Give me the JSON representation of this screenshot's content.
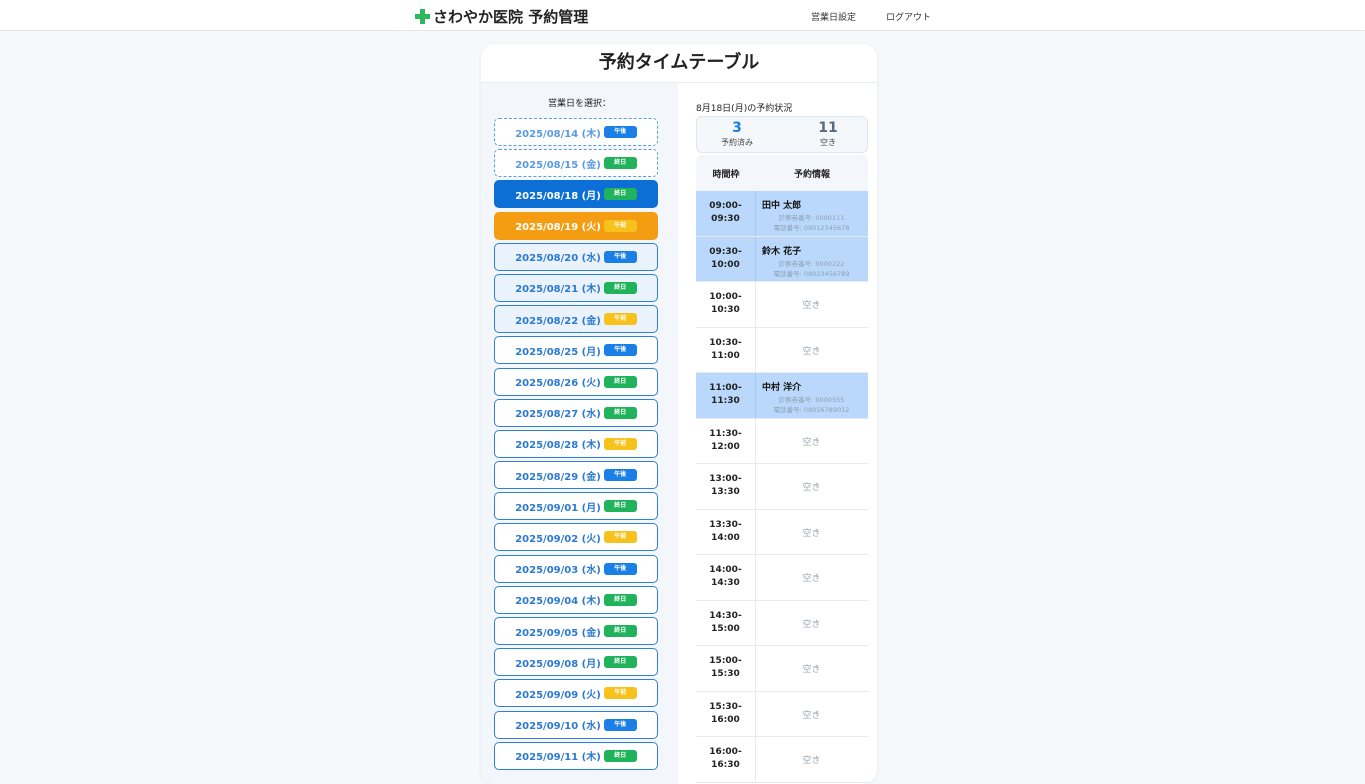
{
  "header": {
    "logo_text": "さわやか医院 予約管理",
    "nav_business_days": "営業日設定",
    "nav_logout": "ログアウト"
  },
  "page": {
    "title": "予約タイムテーブル"
  },
  "left": {
    "label": "営業日を選択：",
    "dates": [
      {
        "label": "2025/08/14 (木)",
        "badge": "午後",
        "badge_type": "afternoon",
        "state": "past"
      },
      {
        "label": "2025/08/15 (金)",
        "badge": "終日",
        "badge_type": "fullday",
        "state": "past"
      },
      {
        "label": "2025/08/18 (月)",
        "badge": "終日",
        "badge_type": "fullday",
        "state": "selected"
      },
      {
        "label": "2025/08/19 (火)",
        "badge": "午前",
        "badge_type": "morning",
        "state": "orange"
      },
      {
        "label": "2025/08/20 (水)",
        "badge": "午後",
        "badge_type": "afternoon",
        "state": "light"
      },
      {
        "label": "2025/08/21 (木)",
        "badge": "終日",
        "badge_type": "fullday",
        "state": "light"
      },
      {
        "label": "2025/08/22 (金)",
        "badge": "午前",
        "badge_type": "morning",
        "state": "light"
      },
      {
        "label": "2025/08/25 (月)",
        "badge": "午後",
        "badge_type": "afternoon",
        "state": "normal"
      },
      {
        "label": "2025/08/26 (火)",
        "badge": "終日",
        "badge_type": "fullday",
        "state": "normal"
      },
      {
        "label": "2025/08/27 (水)",
        "badge": "終日",
        "badge_type": "fullday",
        "state": "normal"
      },
      {
        "label": "2025/08/28 (木)",
        "badge": "午前",
        "badge_type": "morning",
        "state": "normal"
      },
      {
        "label": "2025/08/29 (金)",
        "badge": "午後",
        "badge_type": "afternoon",
        "state": "normal"
      },
      {
        "label": "2025/09/01 (月)",
        "badge": "終日",
        "badge_type": "fullday",
        "state": "normal"
      },
      {
        "label": "2025/09/02 (火)",
        "badge": "午前",
        "badge_type": "morning",
        "state": "normal"
      },
      {
        "label": "2025/09/03 (水)",
        "badge": "午後",
        "badge_type": "afternoon",
        "state": "normal"
      },
      {
        "label": "2025/09/04 (木)",
        "badge": "終日",
        "badge_type": "fullday",
        "state": "normal"
      },
      {
        "label": "2025/09/05 (金)",
        "badge": "終日",
        "badge_type": "fullday",
        "state": "normal"
      },
      {
        "label": "2025/09/08 (月)",
        "badge": "終日",
        "badge_type": "fullday",
        "state": "normal"
      },
      {
        "label": "2025/09/09 (火)",
        "badge": "午前",
        "badge_type": "morning",
        "state": "normal"
      },
      {
        "label": "2025/09/10 (水)",
        "badge": "午後",
        "badge_type": "afternoon",
        "state": "normal"
      },
      {
        "label": "2025/09/11 (木)",
        "badge": "終日",
        "badge_type": "fullday",
        "state": "normal"
      }
    ]
  },
  "right": {
    "status_title": "8月18日(月)の予約状況",
    "booked_count": "3",
    "booked_label": "予約済み",
    "booked_color": "#1a7fe6",
    "free_count": "11",
    "free_label": "空き",
    "free_color": "#5a6b7d",
    "col_time": "時間枠",
    "col_info": "予約情報",
    "slots": [
      {
        "start": "09:00-",
        "end": "09:30",
        "booked": true,
        "name": "田中 太郎",
        "patient_no": "診察券番号: 0000111",
        "phone": "電話番号: 09012345678"
      },
      {
        "start": "09:30-",
        "end": "10:00",
        "booked": true,
        "name": "鈴木 花子",
        "patient_no": "診察券番号: 0000222",
        "phone": "電話番号: 08023456789"
      },
      {
        "start": "10:00-",
        "end": "10:30",
        "booked": false,
        "empty": "空き"
      },
      {
        "start": "10:30-",
        "end": "11:00",
        "booked": false,
        "empty": "空き"
      },
      {
        "start": "11:00-",
        "end": "11:30",
        "booked": true,
        "name": "中村 洋介",
        "patient_no": "診察券番号: 0000555",
        "phone": "電話番号: 08056789012"
      },
      {
        "start": "11:30-",
        "end": "12:00",
        "booked": false,
        "empty": "空き"
      },
      {
        "start": "13:00-",
        "end": "13:30",
        "booked": false,
        "empty": "空き"
      },
      {
        "start": "13:30-",
        "end": "14:00",
        "booked": false,
        "empty": "空き"
      },
      {
        "start": "14:00-",
        "end": "14:30",
        "booked": false,
        "empty": "空き"
      },
      {
        "start": "14:30-",
        "end": "15:00",
        "booked": false,
        "empty": "空き"
      },
      {
        "start": "15:00-",
        "end": "15:30",
        "booked": false,
        "empty": "空き"
      },
      {
        "start": "15:30-",
        "end": "16:00",
        "booked": false,
        "empty": "空き"
      },
      {
        "start": "16:00-",
        "end": "16:30",
        "booked": false,
        "empty": "空き"
      }
    ]
  }
}
